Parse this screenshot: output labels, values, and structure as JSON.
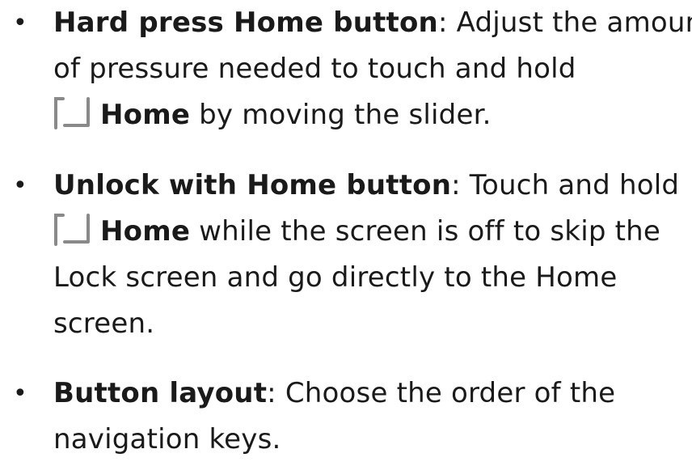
{
  "items": [
    {
      "bullet": "•",
      "term": "Hard press Home button",
      "line1_rest": ": Adjust the amount",
      "line2": "of pressure needed to touch and hold",
      "line3_key": "Home",
      "line3_rest": " by moving the slider."
    },
    {
      "bullet": "•",
      "term": "Unlock with Home button",
      "line1_rest": ": Touch and hold",
      "line2_key": "Home",
      "line2_rest": " while the screen is off to skip the",
      "line3": "Lock screen and go directly to the Home",
      "line4": "screen."
    },
    {
      "bullet": "•",
      "term": "Button layout",
      "line1_rest": ": Choose the order of the",
      "line2": "navigation keys."
    }
  ],
  "icons": {
    "home_key": "home-key-icon",
    "home_key_color": "#8a8a8a"
  }
}
